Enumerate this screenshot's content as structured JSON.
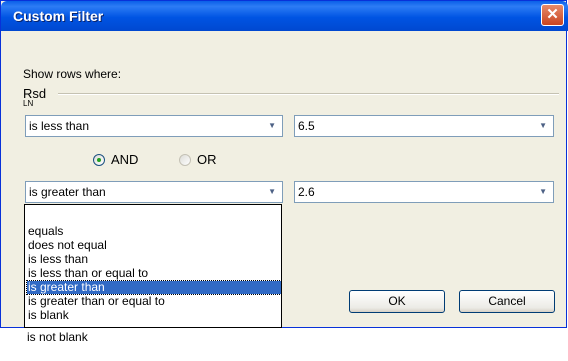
{
  "window": {
    "title": "Custom Filter",
    "close_glyph": "✕"
  },
  "show_rows_label": "Show rows where:",
  "group_label": "Rsd",
  "group_label_cut": "LN",
  "condition1": {
    "operator": "is less than",
    "value": "6.5"
  },
  "logic": {
    "and_label": "AND",
    "or_label": "OR",
    "selected": "AND"
  },
  "condition2": {
    "operator": "is greater than",
    "value": "2.6"
  },
  "buttons": {
    "ok": "OK",
    "cancel": "Cancel"
  },
  "operator_options": [
    "equals",
    "does not equal",
    "is less than",
    "is less than or equal to",
    "is greater than",
    "is greater than or equal to",
    "is blank",
    "is not blank"
  ],
  "selected_option": "is greater than",
  "colors": {
    "titlebar": "#0054e3",
    "dialog_bg": "#f1efe2",
    "selection": "#316ac5"
  }
}
